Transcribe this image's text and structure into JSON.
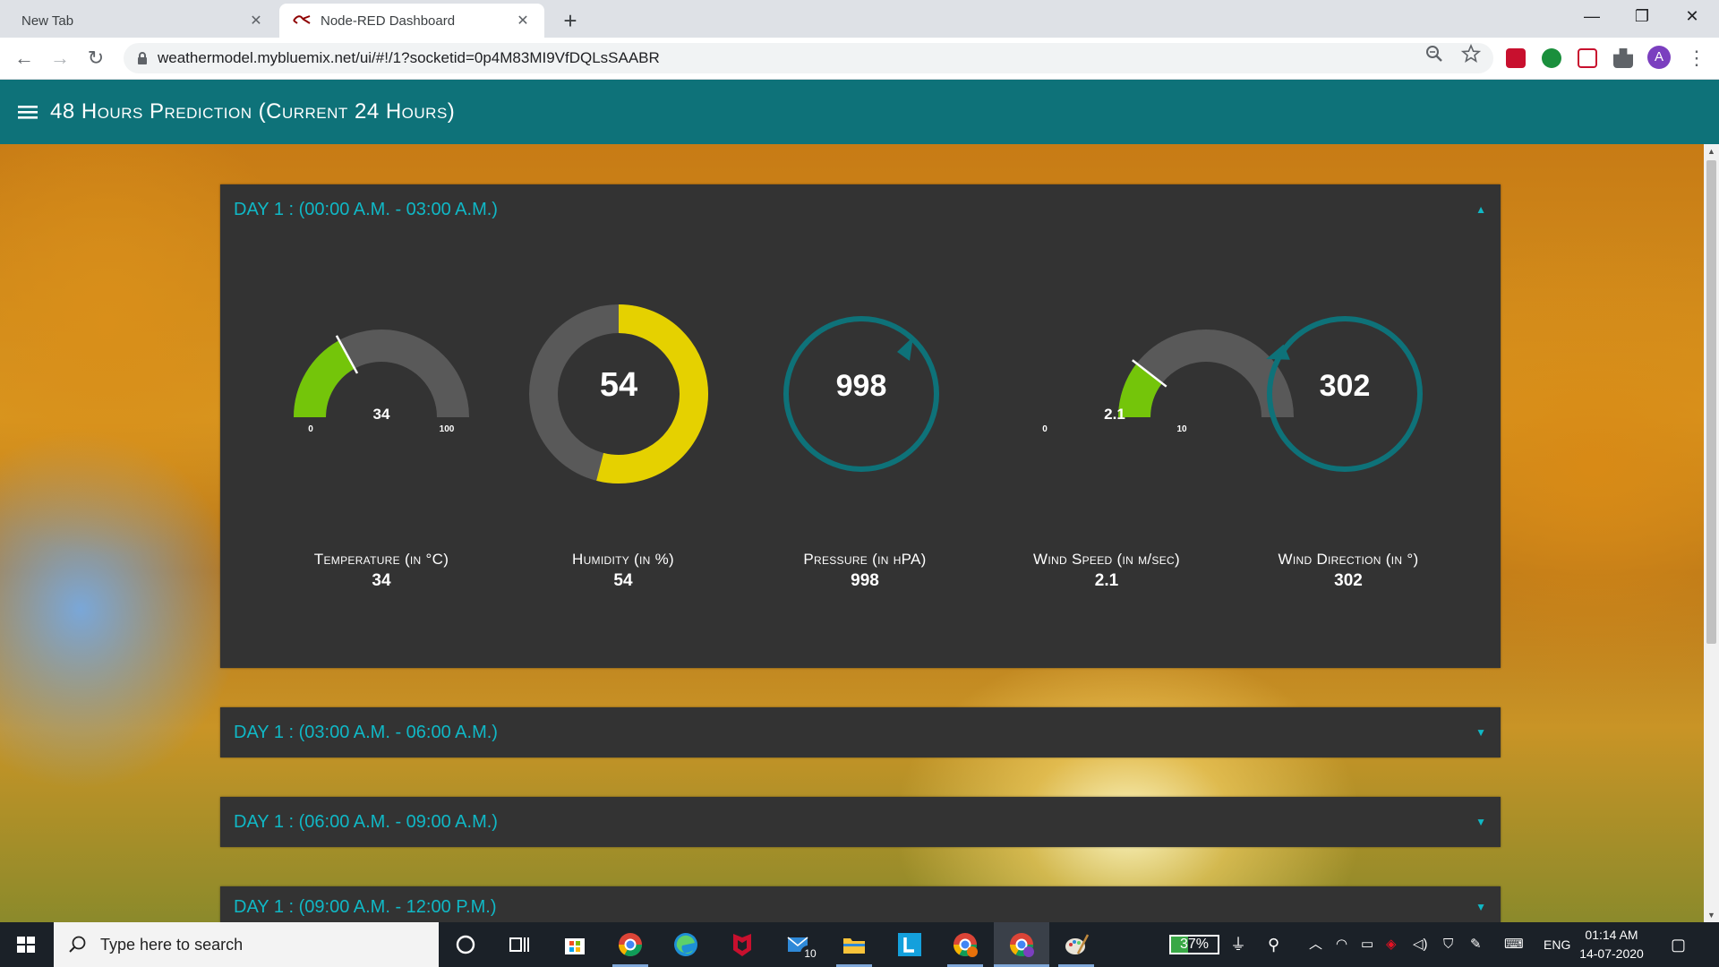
{
  "browser": {
    "tabs": [
      {
        "title": "New Tab",
        "active": false
      },
      {
        "title": "Node-RED Dashboard",
        "active": true
      }
    ],
    "new_tab_symbol": "+",
    "url": "weathermodel.mybluemix.net/ui/#!/1?socketid=0p4M83MI9VfDQLsSAABR",
    "profile_initial": "A"
  },
  "dashboard": {
    "title": "48 Hours Prediction (Current 24 Hours)",
    "colors": {
      "header": "#0e7279",
      "panel": "#333333",
      "accent": "#10b8c6",
      "gauge_green": "#74c50a",
      "gauge_yellow": "#e5d100",
      "ring_teal": "#0e7279"
    },
    "groups": [
      {
        "title": "DAY 1 : (00:00 A.M. - 03:00 A.M.)",
        "expanded": true
      },
      {
        "title": "DAY 1 : (03:00 A.M. - 06:00 A.M.)",
        "expanded": false
      },
      {
        "title": "DAY 1 : (06:00 A.M. - 09:00 A.M.)",
        "expanded": false
      },
      {
        "title": "DAY 1 : (09:00 A.M. - 12:00 P.M.)",
        "expanded": false
      }
    ],
    "widgets": {
      "temperature": {
        "label": "Temperature (in °C)",
        "value": "34",
        "gauge_value": 34,
        "min": "0",
        "max": "100",
        "fraction": 0.34
      },
      "humidity": {
        "label": "Humidity (in %)",
        "value": "54",
        "fraction": 0.54
      },
      "pressure": {
        "label": "Pressure (in hPA)",
        "value": "998"
      },
      "wind_speed": {
        "label": "Wind Speed (in m/sec)",
        "value": "2.1",
        "gauge_value": "2.1",
        "min": "0",
        "max": "10",
        "fraction": 0.21
      },
      "wind_direction": {
        "label": "Wind Direction (in °)",
        "value": "302",
        "degrees": 302
      }
    }
  },
  "taskbar": {
    "search_placeholder": "Type here to search",
    "mail_badge": "10",
    "battery_percent": "37%",
    "battery_level": 0.37,
    "language": "ENG",
    "time": "01:14 AM",
    "date": "14-07-2020"
  }
}
